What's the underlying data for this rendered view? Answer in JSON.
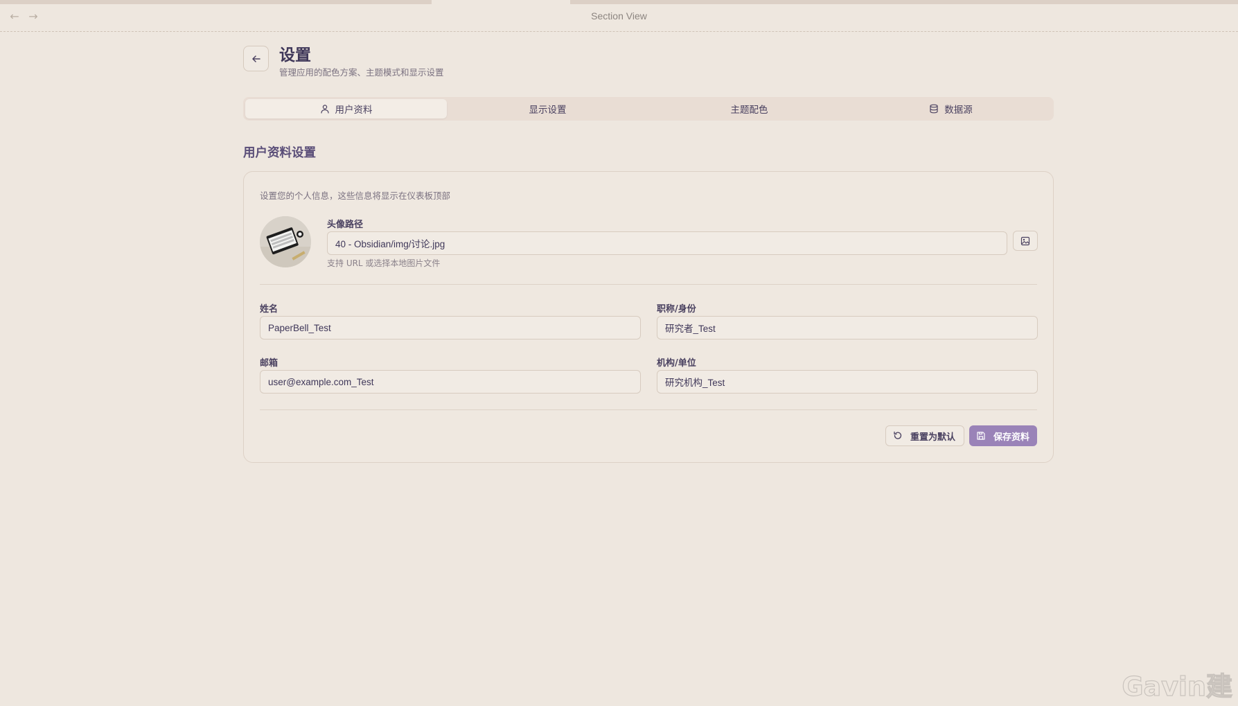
{
  "window": {
    "title": "Section View"
  },
  "header": {
    "title": "设置",
    "subtitle": "管理应用的配色方案、主题模式和显示设置"
  },
  "tabs": [
    {
      "label": "用户资料",
      "icon": "user-icon",
      "active": true
    },
    {
      "label": "显示设置",
      "icon": "",
      "active": false
    },
    {
      "label": "主题配色",
      "icon": "",
      "active": false
    },
    {
      "label": "数据源",
      "icon": "database-icon",
      "active": false
    }
  ],
  "section": {
    "title": "用户资料设置"
  },
  "profile": {
    "description": "设置您的个人信息，这些信息将显示在仪表板顶部",
    "avatar": {
      "label": "头像路径",
      "value": "40 - Obsidian/img/讨论.jpg",
      "hint": "支持 URL 或选择本地图片文件"
    },
    "name": {
      "label": "姓名",
      "value": "PaperBell_Test"
    },
    "role": {
      "label": "职称/身份",
      "value": "研究者_Test"
    },
    "email": {
      "label": "邮箱",
      "value": "user@example.com_Test"
    },
    "org": {
      "label": "机构/单位",
      "value": "研究机构_Test"
    }
  },
  "actions": {
    "reset_label": "重置为默认",
    "save_label": "保存资料"
  },
  "colors": {
    "accent": "#9a83b8",
    "background": "#eee7df",
    "title": "#3f3759"
  }
}
